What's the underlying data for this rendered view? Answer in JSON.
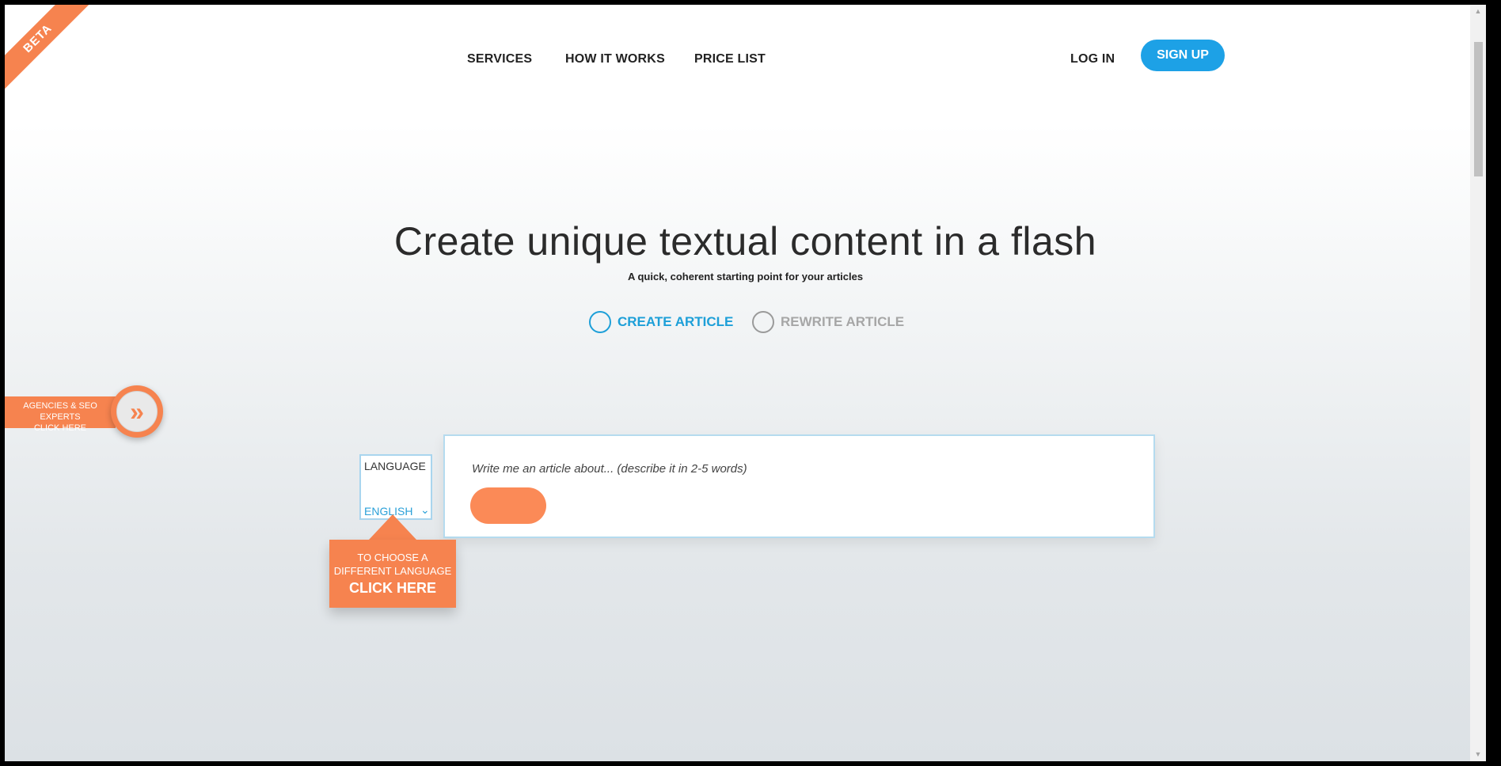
{
  "ribbon": {
    "label": "BETA"
  },
  "nav": {
    "services": "SERVICES",
    "how_it_works": "HOW IT WORKS",
    "price_list": "PRICE LIST",
    "log_in": "LOG IN",
    "sign_up": "SIGN UP"
  },
  "hero": {
    "title": "Create unique textual content in a flash",
    "subtitle": "A quick, coherent starting point for your articles"
  },
  "modes": {
    "create": "CREATE ARTICLE",
    "rewrite": "REWRITE ARTICLE",
    "selected": "create"
  },
  "agency_tab": {
    "line1": "AGENCIES & SEO EXPERTS",
    "line2": "CLICK HERE",
    "icon": "double-chevron-right-icon"
  },
  "language": {
    "label": "LANGUAGE",
    "value": "ENGLISH"
  },
  "article_input": {
    "placeholder": "Write me an article about... (describe it in 2-5 words)",
    "value": ""
  },
  "callout": {
    "line1": "TO CHOOSE A",
    "line2": "DIFFERENT LANGUAGE",
    "line3": "CLICK HERE"
  },
  "colors": {
    "accent_orange": "#f6834f",
    "accent_blue": "#1da1e6"
  }
}
